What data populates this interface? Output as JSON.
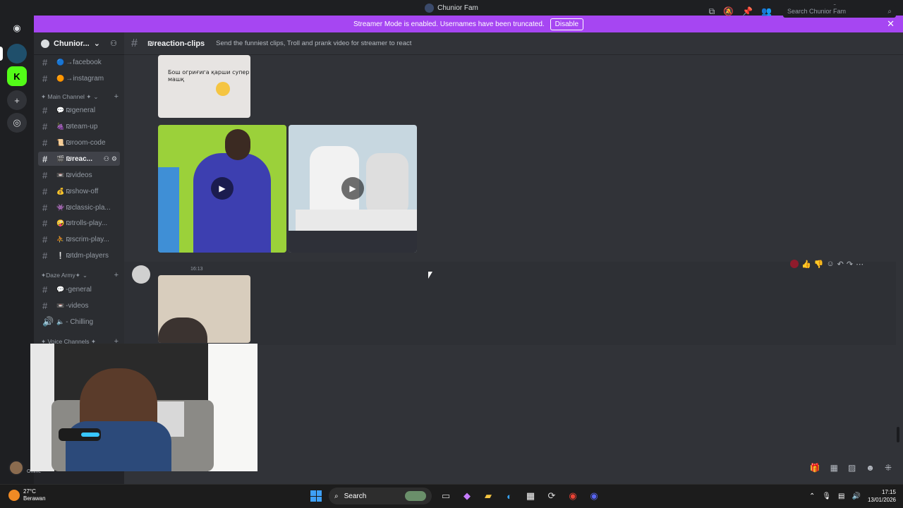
{
  "window": {
    "title": "Chunior Fam"
  },
  "banner": {
    "text": "Streamer Mode is enabled. Usernames have been truncated.",
    "disable_label": "Disable"
  },
  "server": {
    "name": "Chunior..."
  },
  "channels_top": [
    {
      "emoji": "🔵",
      "label": "→facebook"
    },
    {
      "emoji": "🟠",
      "label": "→instagram"
    }
  ],
  "categories": {
    "main": "✦ Main Channel ✦",
    "daze": "✦Daze Army✦",
    "voice": "✦ Voice Channels ✦"
  },
  "main_channels": [
    {
      "emoji": "💬",
      "label": "₪general"
    },
    {
      "emoji": "🍇",
      "label": "₪team-up"
    },
    {
      "emoji": "📜",
      "label": "₪room-code"
    },
    {
      "emoji": "🎬",
      "label": "₪reac...",
      "active": true
    },
    {
      "emoji": "📼",
      "label": "₪videos"
    },
    {
      "emoji": "💰",
      "label": "₪show-off"
    },
    {
      "emoji": "👾",
      "label": "₪classic-pla..."
    },
    {
      "emoji": "🤪",
      "label": "₪trolls-play..."
    },
    {
      "emoji": "⛹",
      "label": "₪scrim-play..."
    },
    {
      "emoji": "❕",
      "label": "₪tdm-players"
    }
  ],
  "daze_channels": [
    {
      "emoji": "💬",
      "label": "-general",
      "type": "text"
    },
    {
      "emoji": "📼",
      "label": "-videos",
      "type": "text"
    },
    {
      "emoji": "🔈",
      "label": "- Chilling",
      "type": "voice"
    }
  ],
  "header": {
    "channel": "₪reaction-clips",
    "topic": "Send the funniest clips, Troll and prank video for streamer to react",
    "search_placeholder": "Search Chunior Fam"
  },
  "messages": {
    "image_caption": "Бош огриғига қарши супер машқ",
    "second_time": "16:13"
  },
  "user": {
    "status": "Online"
  },
  "taskbar": {
    "temp": "27°C",
    "weather": "Berawan",
    "search": "Search",
    "time": "17:15",
    "date": "13/01/2026"
  },
  "colors": {
    "banner": "#a646f2",
    "sidebar": "#2b2d31",
    "chat": "#313338",
    "accent": "#5865f2"
  }
}
